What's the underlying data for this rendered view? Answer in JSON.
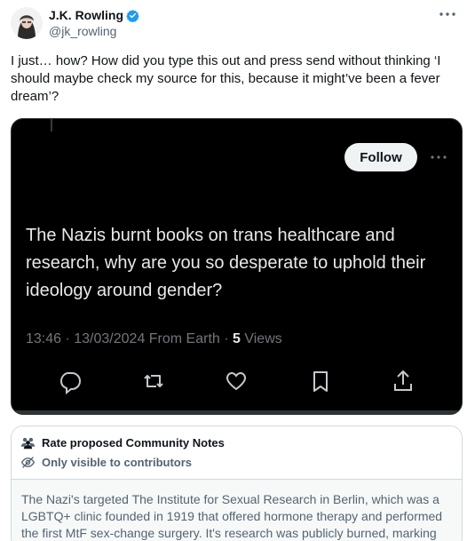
{
  "author": {
    "name": "J.K. Rowling",
    "handle": "@jk_rowling",
    "verified_icon": "verified-badge-icon"
  },
  "tweet": {
    "text": "I just… how? How did you type this out and press send without thinking ‘I should maybe check my source for this, because it might’ve been a fever dream’?"
  },
  "media": {
    "follow_label": "Follow",
    "quote_text": "The Nazis burnt books on trans healthcare and research, why are you so desperate to uphold their ideology around gender?",
    "meta_text": "13:46 · 13/03/2024 From Earth · ",
    "views_count": "5",
    "views_label": " Views"
  },
  "community_notes": {
    "title": "Rate proposed Community Notes",
    "visibility": "Only visible to contributors",
    "note_text": "The Nazi's targeted The Institute for Sexual Research in Berlin, which was a LGBTQ+ clinic founded in 1919 that offered hormone therapy and performed the first MtF sex-change surgery. It's research was publicly burned, marking"
  },
  "colors": {
    "verified": "#1d9bf0",
    "media_bg": "#000000",
    "follow_bg": "#eff3f4",
    "muted": "#536471"
  }
}
